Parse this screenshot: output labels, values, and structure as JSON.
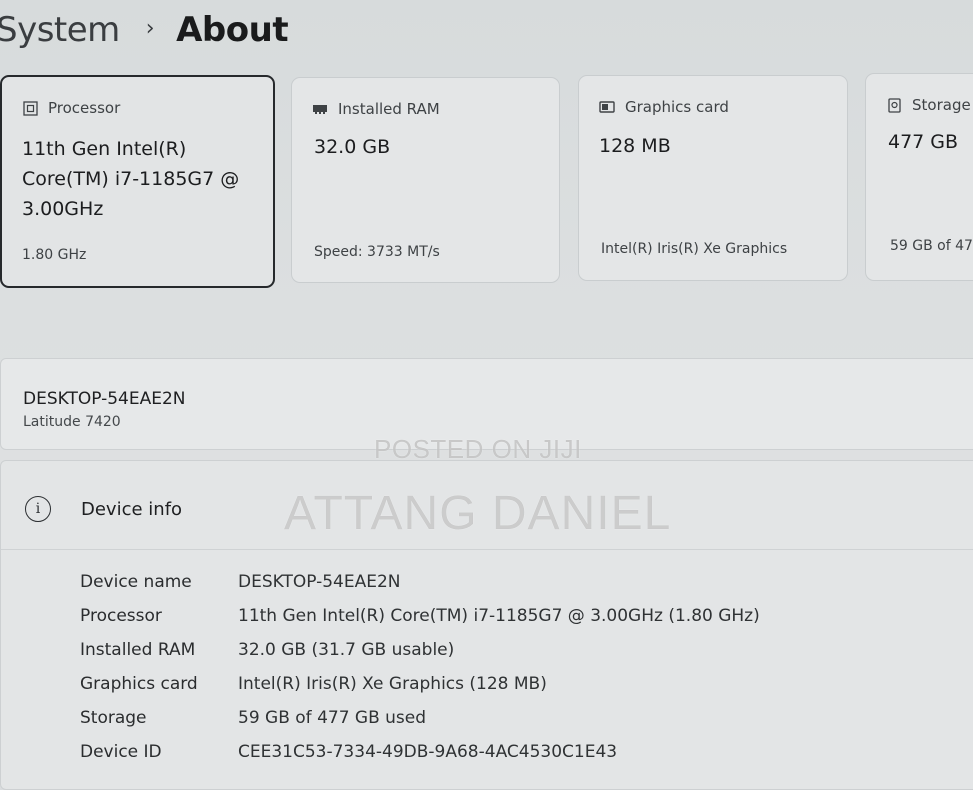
{
  "header": {
    "parent": "System",
    "separator": "›",
    "current": "About"
  },
  "cards": [
    {
      "icon": "processor-icon",
      "title": "Processor",
      "value": "11th Gen Intel(R) Core(TM) i7-1185G7 @ 3.00GHz",
      "sub": "1.80 GHz"
    },
    {
      "icon": "ram-icon",
      "title": "Installed RAM",
      "value": "32.0 GB",
      "sub": "Speed: 3733 MT/s"
    },
    {
      "icon": "graphics-card-icon",
      "title": "Graphics card",
      "value": "128 MB",
      "sub": "Intel(R) Iris(R) Xe Graphics"
    },
    {
      "icon": "storage-icon",
      "title": "Storage",
      "value": "477 GB",
      "sub": "59 GB of 47"
    }
  ],
  "device": {
    "name": "DESKTOP-54EAE2N",
    "model": "Latitude 7420"
  },
  "device_info": {
    "icon": "info-icon",
    "title": "Device info",
    "rows": [
      {
        "key": "Device name",
        "value": "DESKTOP-54EAE2N"
      },
      {
        "key": "Processor",
        "value": "11th Gen Intel(R) Core(TM) i7-1185G7 @ 3.00GHz (1.80 GHz)"
      },
      {
        "key": "Installed RAM",
        "value": "32.0 GB (31.7 GB usable)"
      },
      {
        "key": "Graphics card",
        "value": "Intel(R) Iris(R) Xe Graphics (128 MB)"
      },
      {
        "key": "Storage",
        "value": "59 GB of 477 GB used"
      },
      {
        "key": "Device ID",
        "value": "CEE31C53-7334-49DB-9A68-4AC4530C1E43"
      }
    ]
  },
  "watermarks": {
    "line1": "POSTED ON JIJI",
    "line2": "ATTANG DANIEL"
  },
  "colors": {
    "background": "#dcdfe0",
    "card": "#e4e6e7",
    "selected_border": "#26292c",
    "text": "#1a1a1a"
  }
}
